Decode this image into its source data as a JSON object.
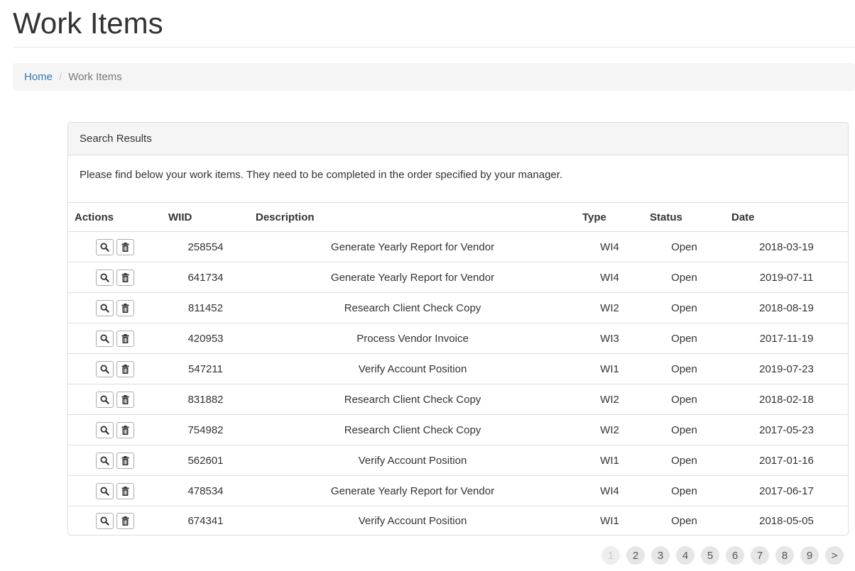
{
  "page": {
    "title": "Work Items"
  },
  "breadcrumb": {
    "home": "Home",
    "separator": "/",
    "current": "Work Items"
  },
  "panel": {
    "heading": "Search Results",
    "intro": "Please find below your work items. They need to be completed in the order specified by your manager."
  },
  "table": {
    "headers": {
      "actions": "Actions",
      "wiid": "WIID",
      "description": "Description",
      "type": "Type",
      "status": "Status",
      "date": "Date"
    },
    "rows": [
      {
        "wiid": "258554",
        "description": "Generate Yearly Report for Vendor",
        "type": "WI4",
        "status": "Open",
        "date": "2018-03-19"
      },
      {
        "wiid": "641734",
        "description": "Generate Yearly Report for Vendor",
        "type": "WI4",
        "status": "Open",
        "date": "2019-07-11"
      },
      {
        "wiid": "811452",
        "description": "Research Client Check Copy",
        "type": "WI2",
        "status": "Open",
        "date": "2018-08-19"
      },
      {
        "wiid": "420953",
        "description": "Process Vendor Invoice",
        "type": "WI3",
        "status": "Open",
        "date": "2017-11-19"
      },
      {
        "wiid": "547211",
        "description": "Verify Account Position",
        "type": "WI1",
        "status": "Open",
        "date": "2019-07-23"
      },
      {
        "wiid": "831882",
        "description": "Research Client Check Copy",
        "type": "WI2",
        "status": "Open",
        "date": "2018-02-18"
      },
      {
        "wiid": "754982",
        "description": "Research Client Check Copy",
        "type": "WI2",
        "status": "Open",
        "date": "2017-05-23"
      },
      {
        "wiid": "562601",
        "description": "Verify Account Position",
        "type": "WI1",
        "status": "Open",
        "date": "2017-01-16"
      },
      {
        "wiid": "478534",
        "description": "Generate Yearly Report for Vendor",
        "type": "WI4",
        "status": "Open",
        "date": "2017-06-17"
      },
      {
        "wiid": "674341",
        "description": "Verify Account Position",
        "type": "WI1",
        "status": "Open",
        "date": "2018-05-05"
      }
    ],
    "row_actions": [
      "search-icon",
      "trash-icon"
    ]
  },
  "pagination": {
    "pages": [
      "1",
      "2",
      "3",
      "4",
      "5",
      "6",
      "7",
      "8",
      "9",
      ">"
    ],
    "current": "1"
  }
}
